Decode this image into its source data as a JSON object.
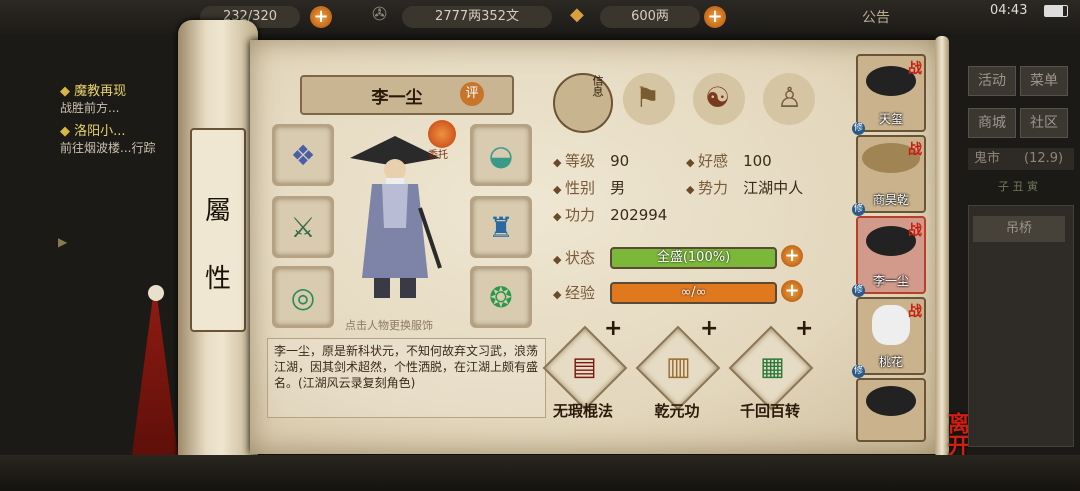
{
  "topbar": {
    "stamina": "232/320",
    "copper": "2777两352文",
    "silver": "600两",
    "notice_label": "公告",
    "clock": "04:43"
  },
  "quests": [
    {
      "title": "魔教再现",
      "desc": "战胜前方..."
    },
    {
      "title": "洛阳小...",
      "desc": "前往烟波楼...行踪"
    }
  ],
  "scroll": {
    "label_top": "屬",
    "label_bottom": "性"
  },
  "character": {
    "name": "李一尘",
    "rate_badge": "评",
    "entrust_badge": "委托",
    "hint": "点击人物更换服饰",
    "tabs": [
      "信息",
      "物品",
      "八卦",
      "经脉"
    ],
    "level_label": "等级",
    "level": "90",
    "favor_label": "好感",
    "favor": "100",
    "gender_label": "性别",
    "gender": "男",
    "faction_label": "势力",
    "faction": "江湖中人",
    "power_label": "功力",
    "power": "202994",
    "status_label": "状态",
    "status_value": "全盛(100%)",
    "status_fill": 1.0,
    "exp_label": "经验",
    "exp_value": "∞/∞",
    "exp_fill": 1.0,
    "description": "李一尘，原是新科状元，不知何故弃文习武，浪荡江湖，因其剑术超然，个性洒脱，在江湖上颇有盛名。(江湖风云录复刻角色)"
  },
  "skills": [
    {
      "name": "无瑕棍法"
    },
    {
      "name": "乾元功"
    },
    {
      "name": "千回百转"
    }
  ],
  "party": [
    {
      "name": "天玺",
      "badge": "战",
      "tag": "修"
    },
    {
      "name": "商昊乾",
      "badge": "战",
      "tag": "修"
    },
    {
      "name": "李一尘",
      "badge": "战",
      "tag": "修"
    },
    {
      "name": "桃花",
      "badge": "战",
      "tag": "修"
    },
    {
      "name": "",
      "badge": "",
      "tag": ""
    }
  ],
  "leave_label": "离开",
  "side_menu": {
    "activity": "活动",
    "menu": "菜单",
    "shop": "商城",
    "community": "社区",
    "market": "鬼市",
    "market_count": "(12.9)",
    "time": "子 丑 寅",
    "bridge": "吊桥"
  },
  "colors": {
    "status_fill": "#7bb83a",
    "exp_fill": "#e0781e",
    "accent": "#c8742a"
  }
}
